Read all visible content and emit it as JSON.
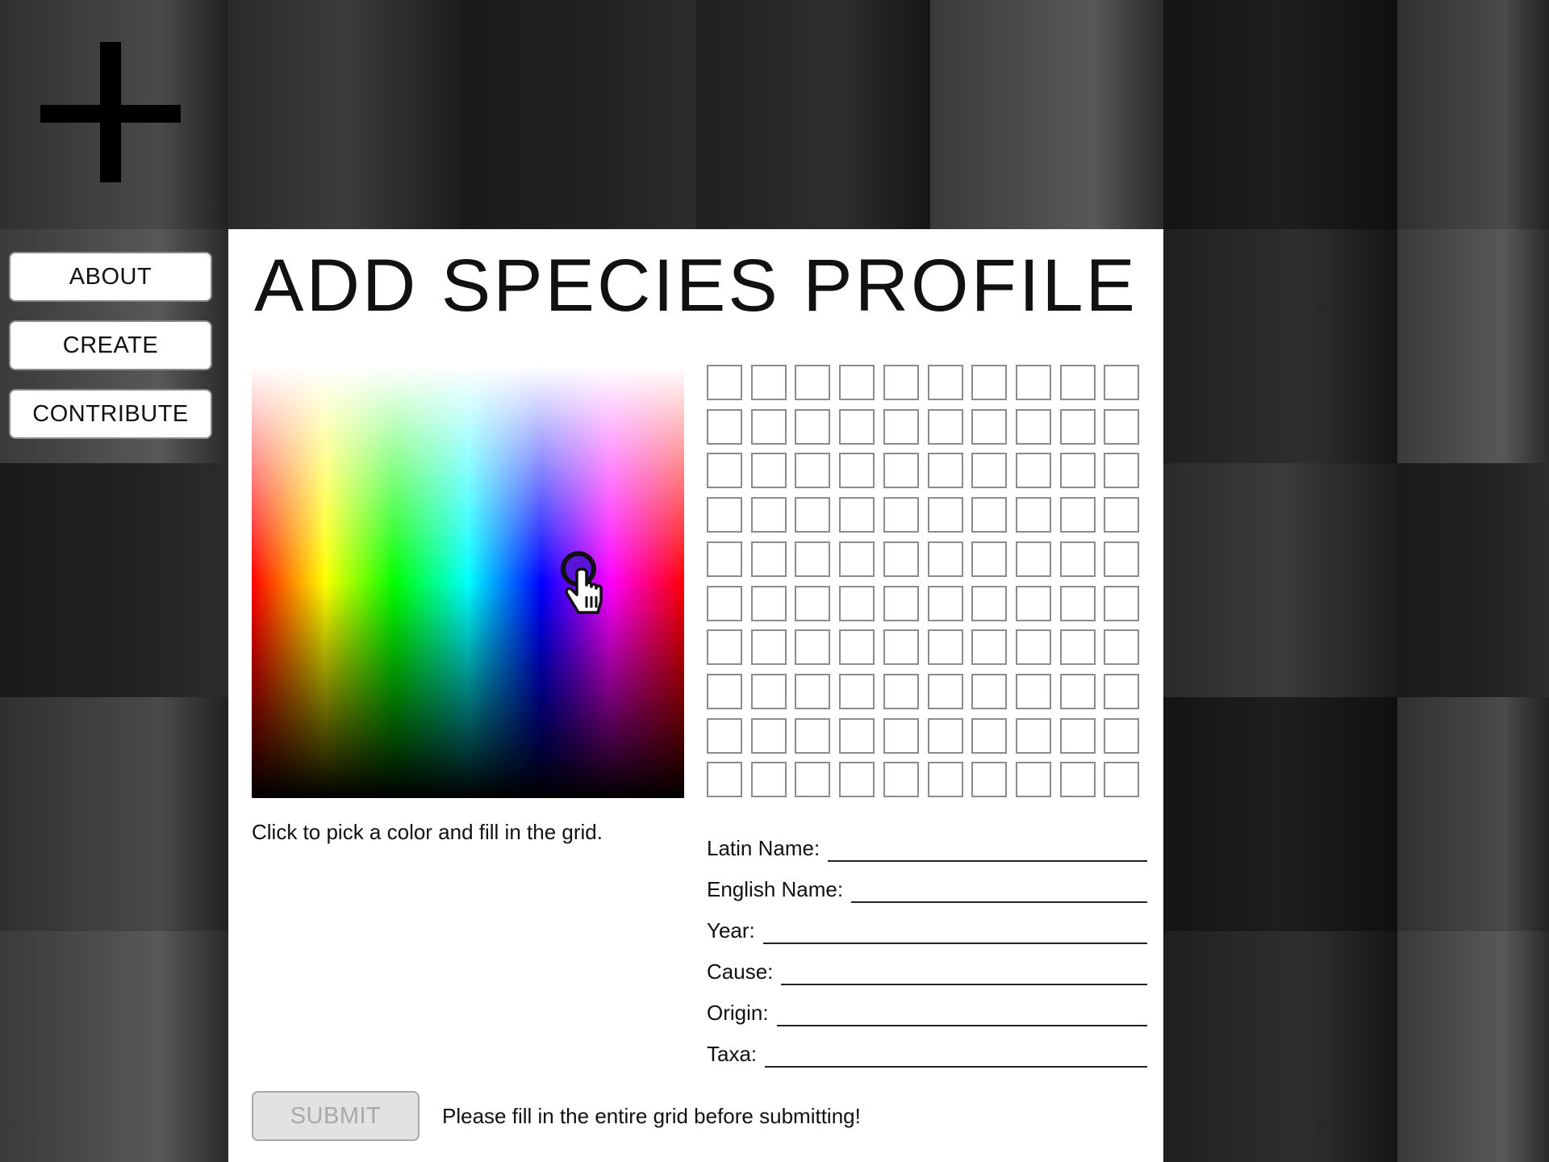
{
  "title": "ADD SPECIES PROFILE",
  "nav": {
    "items": [
      {
        "label": "ABOUT"
      },
      {
        "label": "CREATE"
      },
      {
        "label": "CONTRIBUTE"
      }
    ]
  },
  "picker": {
    "hint": "Click to pick a color and fill in the grid."
  },
  "grid": {
    "rows": 10,
    "cols": 10
  },
  "form": {
    "fields": [
      {
        "label": "Latin Name:",
        "value": ""
      },
      {
        "label": "English Name:",
        "value": ""
      },
      {
        "label": "Year:",
        "value": ""
      },
      {
        "label": "Cause:",
        "value": ""
      },
      {
        "label": "Origin:",
        "value": ""
      },
      {
        "label": "Taxa:",
        "value": ""
      }
    ]
  },
  "submit": {
    "label": "SUBMIT",
    "warning": "Please fill in the entire grid before submitting!"
  },
  "colors": {
    "panel": "#ffffff",
    "background": "#1a1a1a",
    "submit_disabled_bg": "#e2e2e2",
    "submit_disabled_text": "#a8a8a8"
  },
  "icons": {
    "logo": "plus-icon",
    "cursor": "hand-pointer-icon"
  }
}
